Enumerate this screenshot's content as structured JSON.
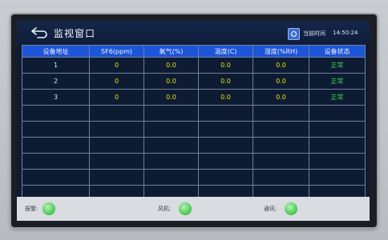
{
  "window": {
    "title": "监视窗口",
    "time_label": "当前时间",
    "time_value": "14:50:24"
  },
  "table": {
    "headers": [
      "设备地址",
      "SF6(ppm)",
      "氧气(%)",
      "温度(C)",
      "湿度(%RH)",
      "设备状态"
    ],
    "rows": [
      {
        "addr": "1",
        "sf6": "0",
        "o2": "0.0",
        "temp": "0.0",
        "hum": "0.0",
        "status": "正常"
      },
      {
        "addr": "2",
        "sf6": "0",
        "o2": "0.0",
        "temp": "0.0",
        "hum": "0.0",
        "status": "正常"
      },
      {
        "addr": "3",
        "sf6": "0",
        "o2": "0.0",
        "temp": "0.0",
        "hum": "0.0",
        "status": "正常"
      }
    ]
  },
  "status": {
    "alarm_label": "报警:",
    "fan_label": "风机:",
    "comm_label": "通讯:",
    "indicator_color": "#4fcf5a"
  },
  "colors": {
    "header_bg": "#1d55d8",
    "value_text": "#e6e600",
    "status_text": "#35d24a",
    "screen_bg": "#0d1b33"
  },
  "icons": [
    "back-arrow-icon",
    "clock-icon",
    "alarm-indicator-icon",
    "fan-indicator-icon",
    "comm-indicator-icon"
  ]
}
